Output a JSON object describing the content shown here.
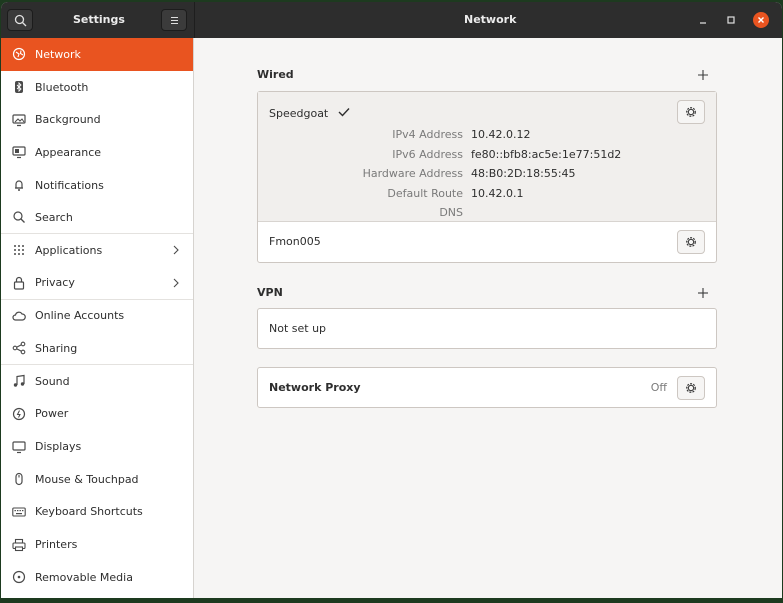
{
  "header": {
    "sidebar_title": "Settings",
    "page_title": "Network"
  },
  "sidebar": {
    "items": [
      {
        "label": "Network",
        "icon": "network-icon"
      },
      {
        "label": "Bluetooth",
        "icon": "bluetooth-icon"
      },
      {
        "label": "Background",
        "icon": "background-icon"
      },
      {
        "label": "Appearance",
        "icon": "appearance-icon"
      },
      {
        "label": "Notifications",
        "icon": "bell-icon"
      },
      {
        "label": "Search",
        "icon": "search-icon"
      },
      {
        "label": "Applications",
        "icon": "apps-grid-icon"
      },
      {
        "label": "Privacy",
        "icon": "lock-icon"
      },
      {
        "label": "Online Accounts",
        "icon": "cloud-icon"
      },
      {
        "label": "Sharing",
        "icon": "share-icon"
      },
      {
        "label": "Sound",
        "icon": "music-note-icon"
      },
      {
        "label": "Power",
        "icon": "power-icon"
      },
      {
        "label": "Displays",
        "icon": "display-icon"
      },
      {
        "label": "Mouse & Touchpad",
        "icon": "mouse-icon"
      },
      {
        "label": "Keyboard Shortcuts",
        "icon": "keyboard-icon"
      },
      {
        "label": "Printers",
        "icon": "printer-icon"
      },
      {
        "label": "Removable Media",
        "icon": "removable-media-icon"
      }
    ]
  },
  "wired": {
    "title": "Wired",
    "connections": [
      {
        "name": "Speedgoat",
        "details": [
          {
            "key": "IPv4 Address",
            "value": "10.42.0.12"
          },
          {
            "key": "IPv6 Address",
            "value": "fe80::bfb8:ac5e:1e77:51d2"
          },
          {
            "key": "Hardware Address",
            "value": "48:B0:2D:18:55:45"
          },
          {
            "key": "Default Route",
            "value": "10.42.0.1"
          },
          {
            "key": "DNS",
            "value": ""
          }
        ]
      },
      {
        "name": "Fmon005"
      }
    ]
  },
  "vpn": {
    "title": "VPN",
    "status": "Not set up"
  },
  "proxy": {
    "label": "Network Proxy",
    "status": "Off"
  },
  "colors": {
    "accent": "#e95420",
    "headerbar": "#2d2d2d",
    "content_bg": "#f6f5f4"
  }
}
